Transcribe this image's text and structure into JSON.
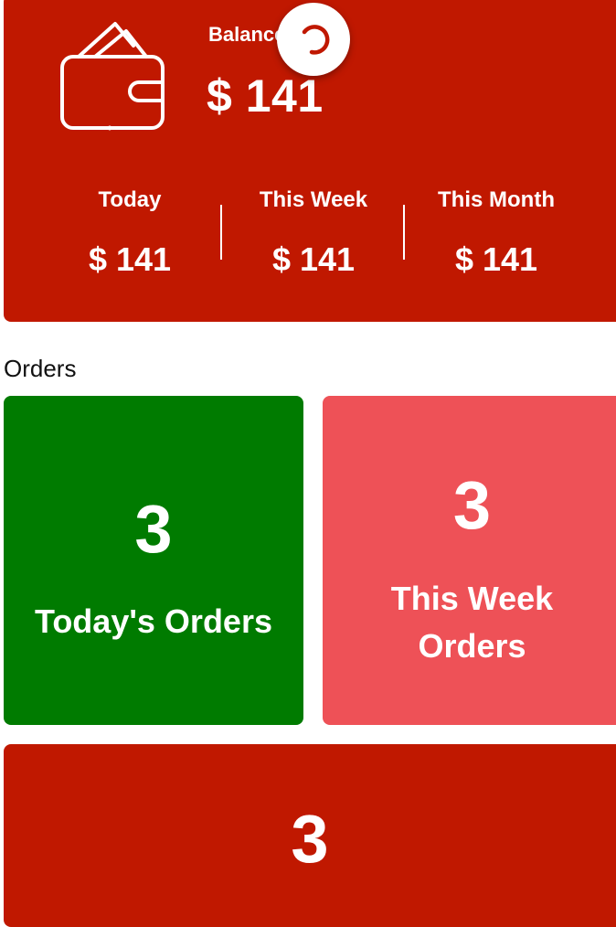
{
  "balance": {
    "label": "Balance",
    "amount": "$ 141",
    "wallet_icon": "wallet-icon",
    "stats": [
      {
        "label": "Today",
        "value": "$ 141"
      },
      {
        "label": "This Week",
        "value": "$ 141"
      },
      {
        "label": "This Month",
        "value": "$ 141"
      }
    ]
  },
  "loading_indicator": {
    "icon": "spinner-icon"
  },
  "orders": {
    "section_title": "Orders",
    "tiles": [
      {
        "count": "3",
        "label": "Today's Orders",
        "color": "#007b00"
      },
      {
        "count": "3",
        "label_line1": "This Week",
        "label_line2": "Orders",
        "color": "#ee5157"
      },
      {
        "count": "3",
        "color": "#c01800"
      }
    ]
  },
  "colors": {
    "primary": "#c01800",
    "success": "#007b00",
    "accent": "#ee5157"
  }
}
